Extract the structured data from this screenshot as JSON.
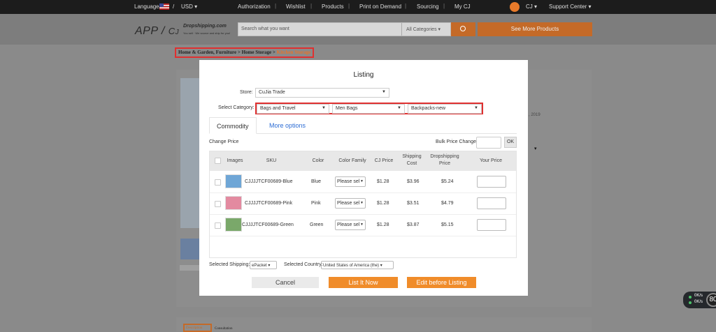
{
  "topbar": {
    "language_label": "Language",
    "slash": "/",
    "currency": "USD",
    "nav": [
      "Authorization",
      "Wishlist",
      "Products",
      "Print on Demand",
      "Sourcing",
      "My CJ"
    ],
    "user": "CJ",
    "support": "Support Center"
  },
  "header": {
    "logo_app": "APP",
    "logo_brand": "Dropshipping.com",
    "logo_tagline": "You sell · We source and ship for you!",
    "search_placeholder": "Search what you want",
    "category": "All Categories",
    "see_more": "See More Products"
  },
  "breadcrumb": {
    "path": "Home & Garden, Furniture > Home Storage > ",
    "current": "Kitchen Storage"
  },
  "background": {
    "date_fragment": ", 2019",
    "tab_description": "Description",
    "tab_consultation": "Consultation"
  },
  "speed_widget": {
    "up": "0K/s",
    "down": "0K/s",
    "percent": "80"
  },
  "modal": {
    "title": "Listing",
    "store_label": "Store:",
    "store_value": "CuJia Trade",
    "category_label": "Select Category:",
    "categories": [
      "Bags and Travel",
      "Men Bags",
      "Backpacks-new"
    ],
    "tabs": [
      "Commodity",
      "More options"
    ],
    "change_price": "Change Price",
    "bulk_price_change": "Bulk Price Change",
    "ok": "OK",
    "columns": [
      "Images",
      "SKU",
      "Color",
      "Color Family",
      "CJ Price",
      "Shipping Cost",
      "Dropshipping Price",
      "Your Price"
    ],
    "rows": [
      {
        "sku": "CJJJJTCF00689-Blue",
        "color": "Blue",
        "family": "Please sele",
        "cj_price": "$1.28",
        "shipping": "$3.96",
        "drop_price": "$5.24",
        "img_color": "#6fa6d6"
      },
      {
        "sku": "CJJJJTCF00689-Pink",
        "color": "Pink",
        "family": "Please sele",
        "cj_price": "$1.28",
        "shipping": "$3.51",
        "drop_price": "$4.79",
        "img_color": "#e38aa0"
      },
      {
        "sku": "CJJJJTCF00689-Green",
        "color": "Green",
        "family": "Please sele",
        "cj_price": "$1.28",
        "shipping": "$3.87",
        "drop_price": "$5.15",
        "img_color": "#7aa86a"
      }
    ],
    "shipping_label": "Selected Shipping:",
    "shipping_value": "ePacket",
    "country_label": "Selected Country:",
    "country_value": "United States of America (the)",
    "cancel": "Cancel",
    "list_now": "List It Now",
    "edit_before": "Edit before Listing"
  },
  "colors": {
    "accent": "#f08c2a",
    "highlight_border": "#e03030",
    "link": "#2c6cd4"
  }
}
